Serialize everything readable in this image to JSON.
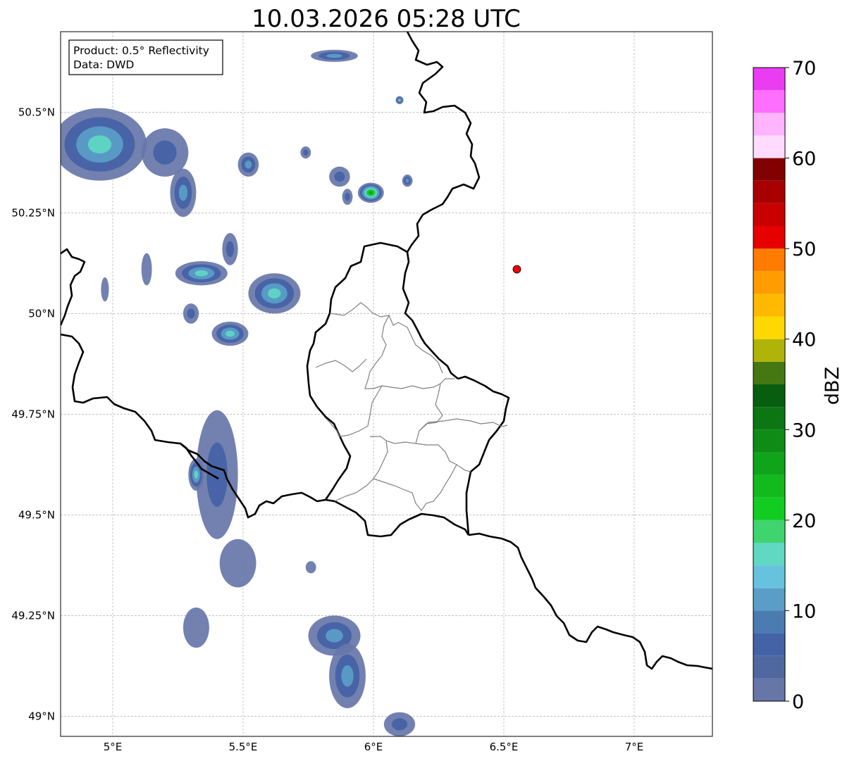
{
  "title": "10.03.2026 05:28 UTC",
  "info_box": {
    "product_line": "Product: 0.5° Reflectivity",
    "data_line": "Data: DWD"
  },
  "map": {
    "lon_range": [
      4.8,
      7.3
    ],
    "lat_range": [
      48.95,
      50.7
    ],
    "lon_ticks": [
      {
        "value": 5.0,
        "label": "5°E"
      },
      {
        "value": 5.5,
        "label": "5.5°E"
      },
      {
        "value": 6.0,
        "label": "6°E"
      },
      {
        "value": 6.5,
        "label": "6.5°E"
      },
      {
        "value": 7.0,
        "label": "7°E"
      }
    ],
    "lat_ticks": [
      {
        "value": 49.0,
        "label": "49°N"
      },
      {
        "value": 49.25,
        "label": "49.25°N"
      },
      {
        "value": 49.5,
        "label": "49.5°N"
      },
      {
        "value": 49.75,
        "label": "49.75°N"
      },
      {
        "value": 50.0,
        "label": "50°N"
      },
      {
        "value": 50.25,
        "label": "50.25°N"
      },
      {
        "value": 50.5,
        "label": "50.5°N"
      }
    ],
    "gridlines": true,
    "radar_site": {
      "lon": 6.55,
      "lat": 50.11,
      "color": "#ee0000"
    },
    "echo_clusters": [
      {
        "lon": 4.95,
        "lat": 50.42,
        "rx": 0.18,
        "ry": 0.09,
        "dbz": 22
      },
      {
        "lon": 5.2,
        "lat": 50.4,
        "rx": 0.09,
        "ry": 0.06,
        "dbz": 12
      },
      {
        "lon": 5.27,
        "lat": 50.3,
        "rx": 0.05,
        "ry": 0.06,
        "dbz": 16
      },
      {
        "lon": 5.52,
        "lat": 50.37,
        "rx": 0.04,
        "ry": 0.03,
        "dbz": 14
      },
      {
        "lon": 5.74,
        "lat": 50.4,
        "rx": 0.02,
        "ry": 0.015,
        "dbz": 8
      },
      {
        "lon": 5.87,
        "lat": 50.34,
        "rx": 0.04,
        "ry": 0.025,
        "dbz": 10
      },
      {
        "lon": 5.9,
        "lat": 50.29,
        "rx": 0.02,
        "ry": 0.02,
        "dbz": 12
      },
      {
        "lon": 5.99,
        "lat": 50.3,
        "rx": 0.05,
        "ry": 0.025,
        "dbz": 28
      },
      {
        "lon": 6.13,
        "lat": 50.33,
        "rx": 0.02,
        "ry": 0.015,
        "dbz": 14
      },
      {
        "lon": 5.85,
        "lat": 50.64,
        "rx": 0.09,
        "ry": 0.015,
        "dbz": 16
      },
      {
        "lon": 6.1,
        "lat": 50.53,
        "rx": 0.015,
        "ry": 0.01,
        "dbz": 18
      },
      {
        "lon": 5.34,
        "lat": 50.1,
        "rx": 0.1,
        "ry": 0.03,
        "dbz": 20
      },
      {
        "lon": 5.13,
        "lat": 50.11,
        "rx": 0.02,
        "ry": 0.04,
        "dbz": 6
      },
      {
        "lon": 4.97,
        "lat": 50.06,
        "rx": 0.015,
        "ry": 0.03,
        "dbz": 6
      },
      {
        "lon": 5.45,
        "lat": 50.16,
        "rx": 0.03,
        "ry": 0.04,
        "dbz": 8
      },
      {
        "lon": 5.62,
        "lat": 50.05,
        "rx": 0.1,
        "ry": 0.05,
        "dbz": 18
      },
      {
        "lon": 5.45,
        "lat": 49.95,
        "rx": 0.07,
        "ry": 0.03,
        "dbz": 20
      },
      {
        "lon": 5.3,
        "lat": 50.0,
        "rx": 0.03,
        "ry": 0.025,
        "dbz": 10
      },
      {
        "lon": 5.4,
        "lat": 49.6,
        "rx": 0.08,
        "ry": 0.16,
        "dbz": 12
      },
      {
        "lon": 5.32,
        "lat": 49.6,
        "rx": 0.03,
        "ry": 0.04,
        "dbz": 20
      },
      {
        "lon": 5.48,
        "lat": 49.38,
        "rx": 0.07,
        "ry": 0.06,
        "dbz": 6
      },
      {
        "lon": 5.76,
        "lat": 49.37,
        "rx": 0.02,
        "ry": 0.015,
        "dbz": 6
      },
      {
        "lon": 5.32,
        "lat": 49.22,
        "rx": 0.05,
        "ry": 0.05,
        "dbz": 6
      },
      {
        "lon": 5.85,
        "lat": 49.2,
        "rx": 0.1,
        "ry": 0.05,
        "dbz": 14
      },
      {
        "lon": 5.9,
        "lat": 49.1,
        "rx": 0.07,
        "ry": 0.08,
        "dbz": 16
      },
      {
        "lon": 6.1,
        "lat": 48.98,
        "rx": 0.06,
        "ry": 0.03,
        "dbz": 8
      }
    ]
  },
  "colorbar": {
    "label": "dBZ",
    "min": 0,
    "max": 70,
    "tick_labels": [
      "0",
      "10",
      "20",
      "30",
      "40",
      "50",
      "60",
      "70"
    ],
    "levels": [
      {
        "from": 0,
        "to": 2.5,
        "color": "#6676a8"
      },
      {
        "from": 2.5,
        "to": 5,
        "color": "#5068a0"
      },
      {
        "from": 5,
        "to": 7.5,
        "color": "#4462a6"
      },
      {
        "from": 7.5,
        "to": 10,
        "color": "#4a7cb2"
      },
      {
        "from": 10,
        "to": 12.5,
        "color": "#5a9ec8"
      },
      {
        "from": 12.5,
        "to": 15,
        "color": "#66c2de"
      },
      {
        "from": 15,
        "to": 17.5,
        "color": "#60d8c2"
      },
      {
        "from": 17.5,
        "to": 20,
        "color": "#3fd46e"
      },
      {
        "from": 20,
        "to": 22.5,
        "color": "#12cc22"
      },
      {
        "from": 22.5,
        "to": 25,
        "color": "#12ba1e"
      },
      {
        "from": 25,
        "to": 27.5,
        "color": "#10a41a"
      },
      {
        "from": 27.5,
        "to": 30,
        "color": "#0e8c16"
      },
      {
        "from": 30,
        "to": 32.5,
        "color": "#0c7612"
      },
      {
        "from": 32.5,
        "to": 35,
        "color": "#075e0e"
      },
      {
        "from": 35,
        "to": 37.5,
        "color": "#457812"
      },
      {
        "from": 37.5,
        "to": 40,
        "color": "#b0b408"
      },
      {
        "from": 40,
        "to": 42.5,
        "color": "#fed800"
      },
      {
        "from": 42.5,
        "to": 45,
        "color": "#ffba00"
      },
      {
        "from": 45,
        "to": 47.5,
        "color": "#ff9c00"
      },
      {
        "from": 47.5,
        "to": 50,
        "color": "#ff7c00"
      },
      {
        "from": 50,
        "to": 52.5,
        "color": "#e60000"
      },
      {
        "from": 52.5,
        "to": 55,
        "color": "#c80000"
      },
      {
        "from": 55,
        "to": 57.5,
        "color": "#a80000"
      },
      {
        "from": 57.5,
        "to": 60,
        "color": "#820000"
      },
      {
        "from": 60,
        "to": 62.5,
        "color": "#ffdcff"
      },
      {
        "from": 62.5,
        "to": 65,
        "color": "#ffb4ff"
      },
      {
        "from": 65,
        "to": 67.5,
        "color": "#ff6eff"
      },
      {
        "from": 67.5,
        "to": 70,
        "color": "#ea3cf2"
      }
    ]
  }
}
